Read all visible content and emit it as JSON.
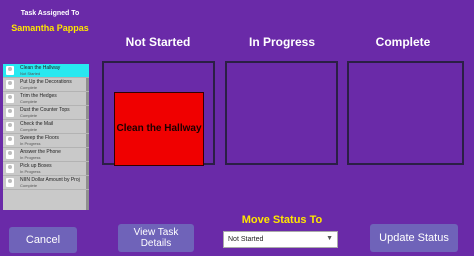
{
  "header": {
    "assigned_label": "Task Assigned To",
    "assignee_name": "Samantha Pappas"
  },
  "columns": [
    "Not Started",
    "In Progress",
    "Complete"
  ],
  "tasks": [
    {
      "title": "Clean the Hallway",
      "status": "Not Started",
      "selected": true
    },
    {
      "title": "Put Up the Decorations",
      "status": "Complete"
    },
    {
      "title": "Trim the Hedges",
      "status": "Complete"
    },
    {
      "title": "Dust the Counter Tops",
      "status": "Complete"
    },
    {
      "title": "Check the Mail",
      "status": "Complete"
    },
    {
      "title": "Sweep the Floors",
      "status": "In Progress"
    },
    {
      "title": "Answer the Phone",
      "status": "In Progress"
    },
    {
      "title": "Pick up Boxes",
      "status": "In Progress"
    },
    {
      "title": "NIIN Dollar Amount by Proj",
      "status": "Complete"
    }
  ],
  "card": {
    "title": "Clean the Hallway"
  },
  "buttons": {
    "cancel": "Cancel",
    "view_details": "View Task Details",
    "update_status": "Update Status"
  },
  "move_status": {
    "label": "Move Status To",
    "selected": "Not Started"
  },
  "colors": {
    "background": "#6a2aa8",
    "accent_yellow": "#ffe600",
    "card_red": "#f00000",
    "selected_cyan": "#28e8f0",
    "button": "#6f63b9"
  },
  "icons": {
    "avatar": "person-avatar-icon",
    "dropdown": "chevron-down-icon"
  }
}
